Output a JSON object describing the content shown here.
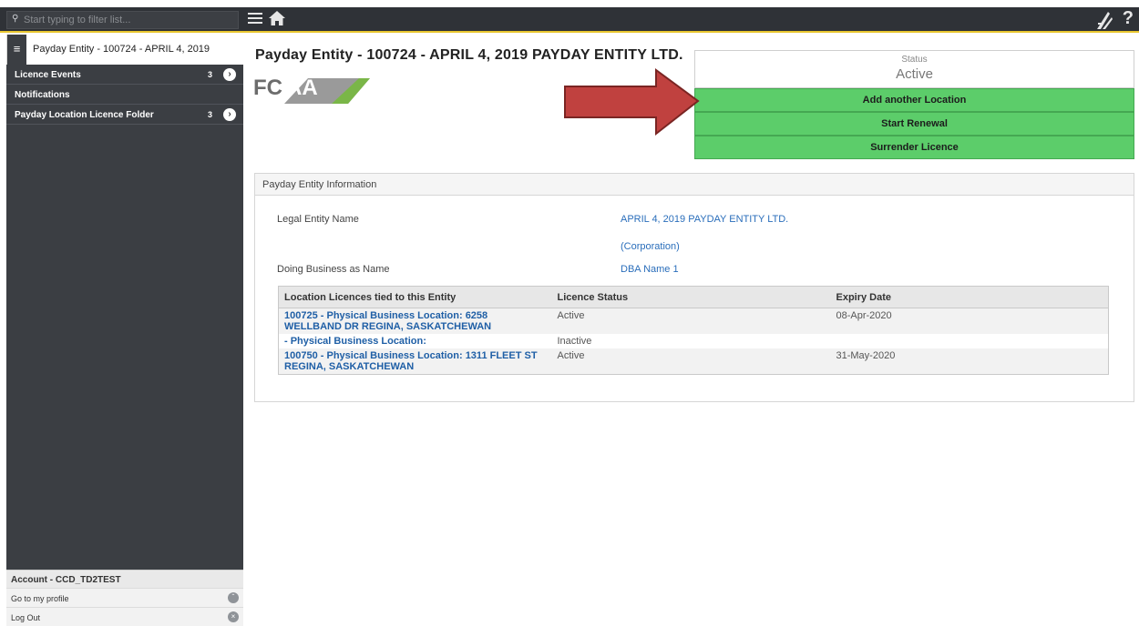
{
  "filter": {
    "placeholder": "Start typing to filter list..."
  },
  "sidebar": {
    "header": "Payday Entity - 100724 - APRIL 4, 2019",
    "items": [
      {
        "label": "Licence Events",
        "count": "3"
      },
      {
        "label": "Notifications",
        "count": ""
      },
      {
        "label": "Payday Location Licence Folder",
        "count": "3"
      }
    ],
    "account": "Account - CCD_TD2TEST",
    "links": [
      {
        "label": "Go to my profile"
      },
      {
        "label": "Log Out"
      }
    ]
  },
  "topbar": {
    "help": "?"
  },
  "page": {
    "title": "Payday Entity - 100724 - APRIL 4, 2019 PAYDAY ENTITY LTD.",
    "logo_text_fc": "FC",
    "logo_text_aa": "AA"
  },
  "status": {
    "label": "Status",
    "value": "Active"
  },
  "actions": {
    "add_location": "Add another Location",
    "start_renewal": "Start Renewal",
    "surrender": "Surrender Licence"
  },
  "panel": {
    "heading": "Payday Entity Information",
    "legal_label": "Legal Entity Name",
    "legal_value": "APRIL 4, 2019 PAYDAY ENTITY LTD.",
    "legal_type": "(Corporation)",
    "dba_label": "Doing Business as Name",
    "dba_value": "DBA Name 1"
  },
  "table": {
    "headers": [
      "Location Licences tied to this Entity",
      "Licence Status",
      "Expiry Date"
    ],
    "rows": [
      {
        "location": "100725 - Physical Business Location: 6258 WELLBAND DR REGINA, SASKATCHEWAN",
        "status": "Active",
        "expiry": "08-Apr-2020"
      },
      {
        "location": "- Physical Business Location:",
        "status": "Inactive",
        "expiry": ""
      },
      {
        "location": "100750 - Physical Business Location: 1311 FLEET ST REGINA, SASKATCHEWAN",
        "status": "Active",
        "expiry": "31-May-2020"
      }
    ]
  },
  "colors": {
    "topbar": "#2f3237",
    "sidebar": "#3b3e43",
    "accent_yellow": "#e8c630",
    "action_green": "#5ccd6a",
    "link_blue": "#1f5fa6",
    "arrow_red": "#c0413f"
  },
  "icons": {
    "search": "search-icon",
    "menu": "hamburger-menu-icon",
    "home": "home-icon",
    "brand": "saskatchewan-wheat-icon",
    "help": "help-icon",
    "entity": "entity-icon",
    "chevron": "chevron-right-icon",
    "profile": "chevron-up-icon",
    "logout": "close-icon"
  }
}
